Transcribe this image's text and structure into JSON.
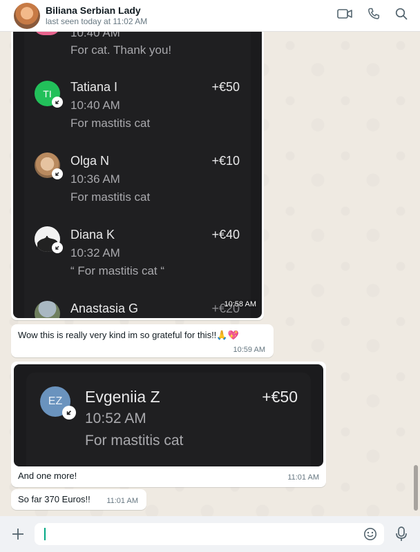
{
  "header": {
    "contact_name": "Biliana Serbian Lady",
    "status": "last seen today at 11:02 AM",
    "icons": [
      "video-call-icon",
      "phone-icon",
      "search-icon"
    ]
  },
  "image1": {
    "partial_top": {
      "time": "10:40 AM",
      "note": "For cat. Thank you!"
    },
    "entries": [
      {
        "name": "Tatiana I",
        "amount": "+€50",
        "time": "10:40 AM",
        "note": "For mastitis cat",
        "initials": "TI"
      },
      {
        "name": "Olga N",
        "amount": "+€10",
        "time": "10:36 AM",
        "note": "For mastitis cat"
      },
      {
        "name": "Diana K",
        "amount": "+€40",
        "time": "10:32 AM",
        "note": "“ For mastitis cat “"
      },
      {
        "name": "Anastasia G",
        "amount": "+€20"
      }
    ],
    "timestamp": "10:58 AM"
  },
  "messages": [
    {
      "text": "Wow this is really very kind im so grateful for this!!🙏💖",
      "time": "10:59 AM"
    }
  ],
  "image2": {
    "initials": "EZ",
    "name": "Evgeniia Z",
    "amount": "+€50",
    "time": "10:52 AM",
    "note": "For mastitis cat",
    "caption": "And one more!",
    "caption_time": "11:01 AM"
  },
  "last_message": {
    "text": "So far 370 Euros!!",
    "time": "11:01 AM"
  },
  "footer": {
    "input_value": "",
    "icons": [
      "plus-icon",
      "emoji-icon",
      "microphone-icon"
    ]
  },
  "colors": {
    "header_bg": "#ffffff",
    "chat_bg": "#efeae2",
    "bubble_bg": "#ffffff",
    "green_avatar": "#22c05a",
    "ez_avatar": "#6a93be",
    "accent": "#00a884"
  }
}
